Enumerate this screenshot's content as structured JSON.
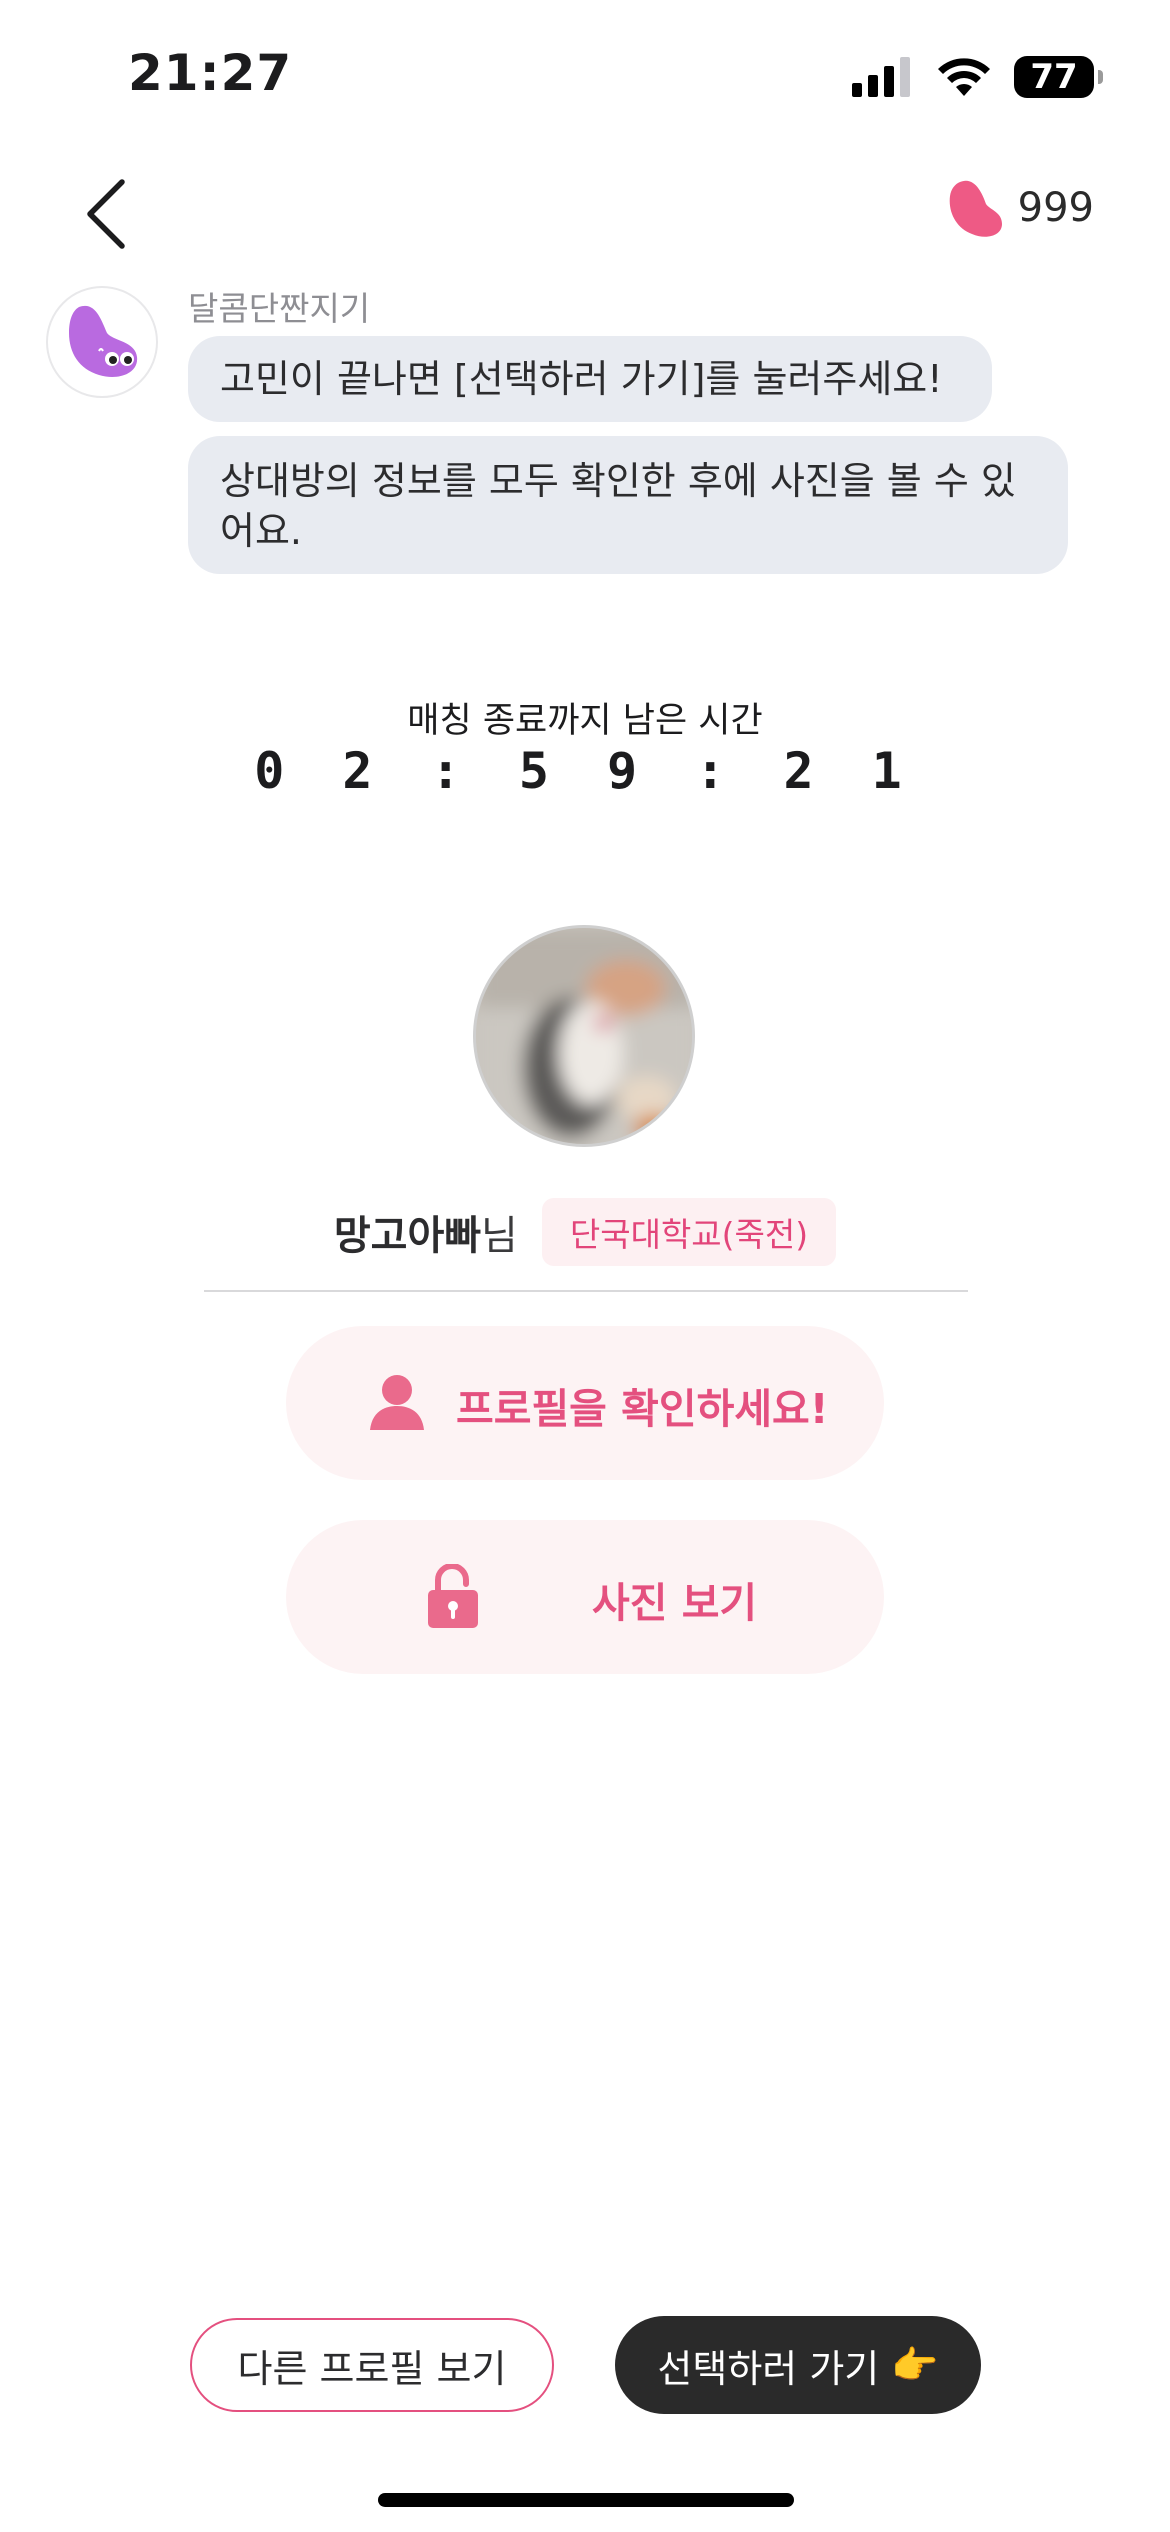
{
  "status_bar": {
    "time": "21:27",
    "battery": "77",
    "icons": [
      "signal-icon",
      "wifi-icon",
      "battery-icon"
    ]
  },
  "header": {
    "back_icon": "chevron-left-icon",
    "credit_icon": "jellybean-icon",
    "credit_count": "999"
  },
  "chat": {
    "bot_name": "달콤단짠지기",
    "messages": [
      "고민이 끝나면 [선택하러 가기]를 눌러주세요!",
      "상대방의 정보를 모두 확인한 후에 사진을 볼 수 있어요."
    ]
  },
  "timer": {
    "label": "매칭 종료까지 남은 시간",
    "value": "02:59:21"
  },
  "profile": {
    "name": "망고아빠",
    "suffix": "님",
    "school": "단국대학교(죽전)"
  },
  "actions": {
    "profile_label": "프로필을 확인하세요!",
    "photo_label": "사진 보기"
  },
  "bottom": {
    "other_label": "다른 프로필 보기",
    "select_label": "선택하러 가기",
    "select_emoji": "👉"
  },
  "colors": {
    "accent": "#e4507f",
    "accent_bg": "#fdf3f4",
    "bubble_bg": "#e8ebf1",
    "dark_button": "#2a2a2a",
    "bot_purple": "#b96ae0"
  }
}
